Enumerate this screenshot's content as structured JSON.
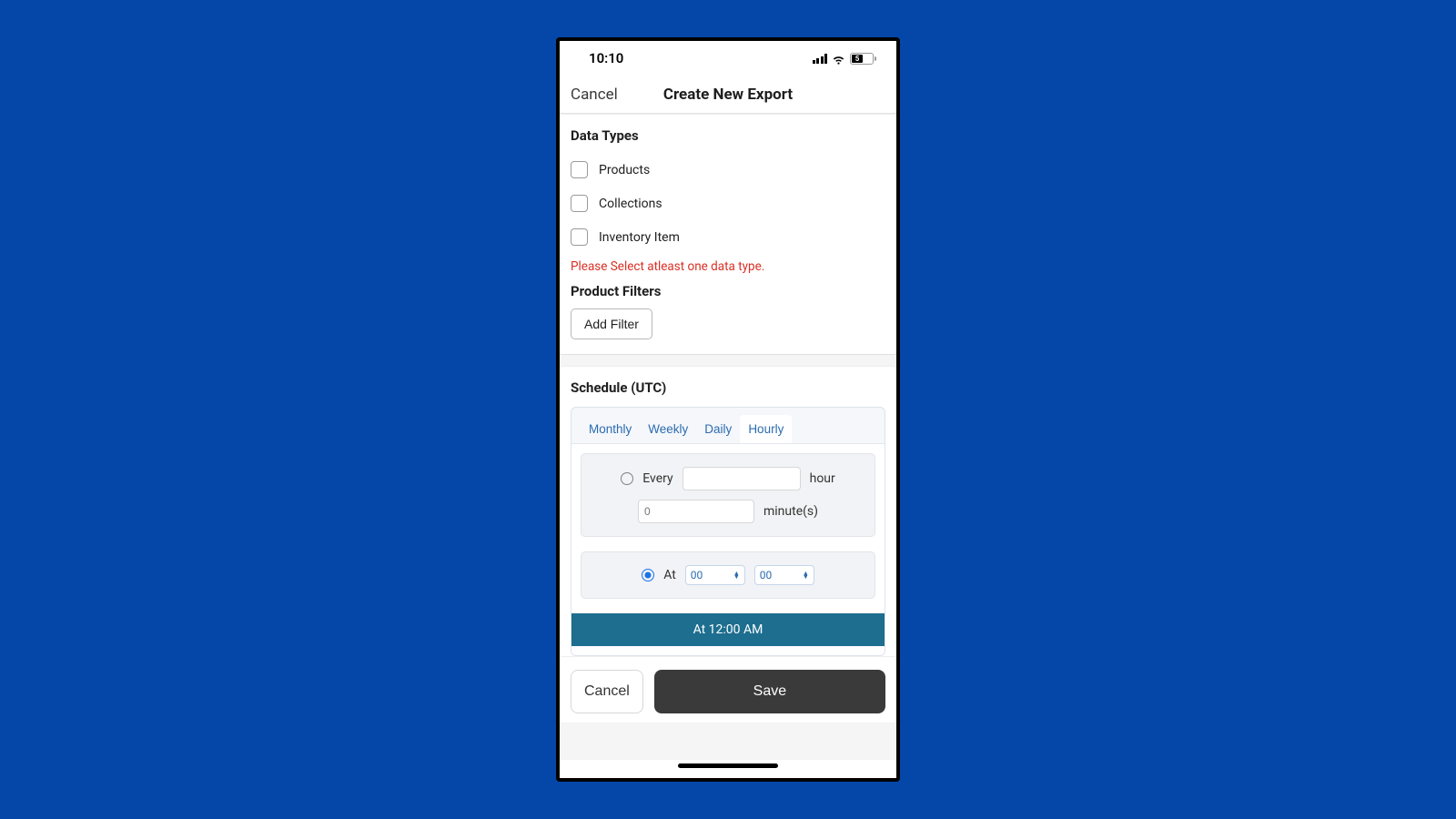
{
  "status": {
    "time": "10:10",
    "battery_text": "5"
  },
  "nav": {
    "cancel": "Cancel",
    "title": "Create New Export"
  },
  "data_types": {
    "heading": "Data Types",
    "items": [
      "Products",
      "Collections",
      "Inventory Item"
    ],
    "error": "Please Select atleast one data type."
  },
  "product_filters": {
    "heading": "Product Filters",
    "add": "Add Filter"
  },
  "schedule": {
    "heading": "Schedule (UTC)",
    "tabs": [
      "Monthly",
      "Weekly",
      "Daily",
      "Hourly"
    ],
    "every_label": "Every",
    "hour_label": "hour",
    "minutes_label": "minute(s)",
    "minutes_placeholder": "0",
    "at_label": "At",
    "hour_value": "00",
    "minute_value": "00",
    "summary": "At 12:00 AM"
  },
  "footer": {
    "cancel": "Cancel",
    "save": "Save"
  }
}
